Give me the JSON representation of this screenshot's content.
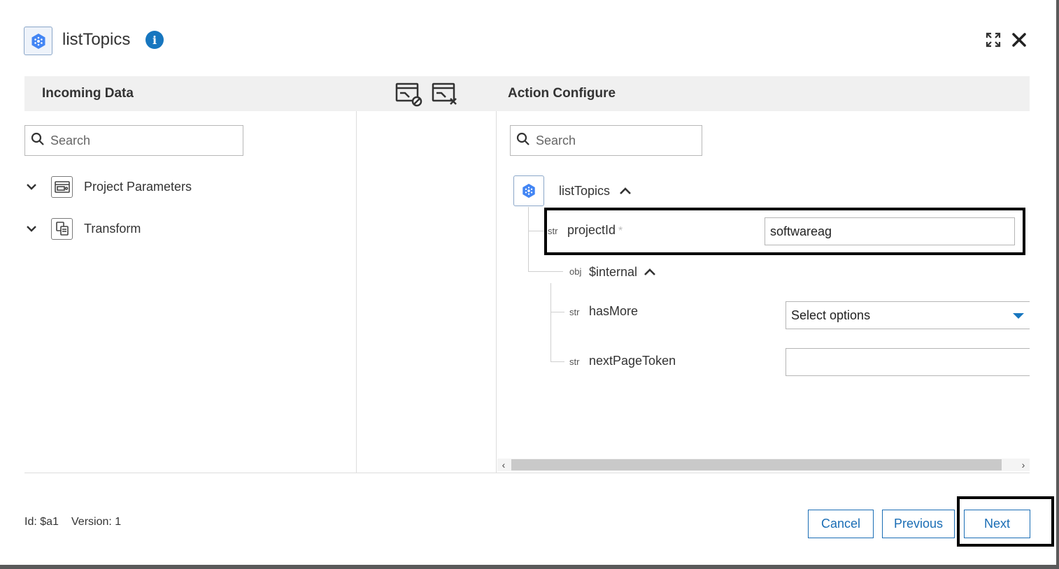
{
  "dialog": {
    "title": "listTopics",
    "info_icon": "info-icon",
    "expand_icon": "expand-icon",
    "close_icon": "close-icon"
  },
  "left_panel": {
    "title": "Incoming Data",
    "search_placeholder": "Search",
    "items": [
      {
        "label": "Project Parameters",
        "icon": "project-parameters-icon"
      },
      {
        "label": "Transform",
        "icon": "transform-icon"
      }
    ]
  },
  "toolbar": {
    "icons": [
      "hide-mapped-icon",
      "clear-mapping-icon"
    ]
  },
  "right_panel": {
    "title": "Action Configure",
    "search_placeholder": "Search",
    "root": {
      "label": "listTopics"
    },
    "fields": [
      {
        "type": "str",
        "label": "projectId",
        "required": "*",
        "value": "softwareag"
      },
      {
        "type": "obj",
        "label": "$internal"
      },
      {
        "type": "str",
        "label": "hasMore",
        "value": "Select options"
      },
      {
        "type": "str",
        "label": "nextPageToken",
        "value": ""
      }
    ]
  },
  "footer": {
    "id_text": "Id: $a1",
    "version_text": "Version: 1",
    "cancel_label": "Cancel",
    "previous_label": "Previous",
    "next_label": "Next"
  },
  "colors": {
    "accent": "#1776bf",
    "header_bg": "#f0f0f0",
    "button_border": "#1a6db5"
  }
}
